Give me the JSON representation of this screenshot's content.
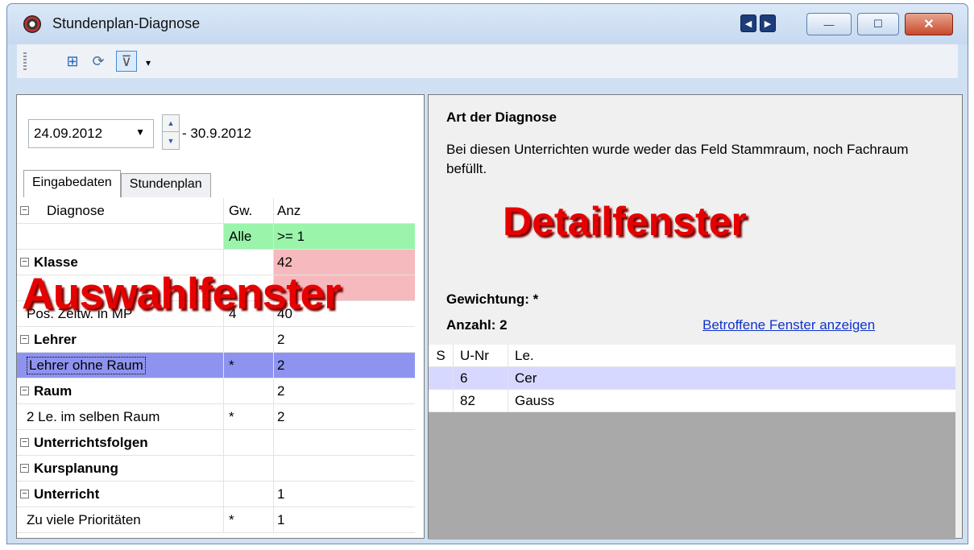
{
  "window": {
    "title": "Stundenplan-Diagnose"
  },
  "titlebar_buttons": {
    "prev": "◀",
    "next": "▶",
    "minimize": "—",
    "maximize": "☐",
    "close": "✕"
  },
  "toolbar": {
    "tools": [
      "grid-tool-icon",
      "refresh-tool-icon",
      "filter-tool-icon"
    ]
  },
  "date_range": {
    "start": "24.09.2012",
    "end": "- 30.9.2012"
  },
  "tabs": [
    {
      "label": "Eingabedaten"
    },
    {
      "label": "Stundenplan"
    }
  ],
  "grid": {
    "headers": {
      "diagnose": "Diagnose",
      "weight": "Gw.",
      "count": "Anz"
    },
    "filter": {
      "weight": "Alle",
      "count": ">= 1"
    },
    "rows": [
      {
        "label": "Klasse",
        "group": true,
        "weight": "",
        "count": "42"
      },
      {
        "label": "",
        "group": false,
        "weight": "",
        "count": ""
      },
      {
        "label": "Pos. Zeitw. in MP",
        "group": false,
        "weight": "4",
        "count": "40"
      },
      {
        "label": "Lehrer",
        "group": true,
        "weight": "",
        "count": "2"
      },
      {
        "label": "Lehrer ohne Raum",
        "group": false,
        "weight": "*",
        "count": "2"
      },
      {
        "label": "Raum",
        "group": true,
        "weight": "",
        "count": "2"
      },
      {
        "label": "2 Le. im selben Raum",
        "group": false,
        "weight": "*",
        "count": "2"
      },
      {
        "label": "Unterrichtsfolgen",
        "group": true,
        "weight": "",
        "count": ""
      },
      {
        "label": "Kursplanung",
        "group": true,
        "weight": "",
        "count": ""
      },
      {
        "label": "Unterricht",
        "group": true,
        "weight": "",
        "count": "1"
      },
      {
        "label": "Zu viele Prioritäten",
        "group": false,
        "weight": "*",
        "count": "1"
      }
    ]
  },
  "overlays": {
    "left": "Auswahlfenster",
    "right": "Detailfenster"
  },
  "detail": {
    "title": "Art der Diagnose",
    "description": "Bei diesen Unterrichten wurde weder das Feld Stammraum, noch Fachraum befüllt.",
    "weight": "Gewichtung: *",
    "count": "Anzahl: 2",
    "link": "Betroffene Fenster anzeigen",
    "table": {
      "headers": {
        "s": "S",
        "unr": "U-Nr",
        "le": "Le."
      },
      "rows": [
        {
          "s": "",
          "unr": "6",
          "le": "Cer"
        },
        {
          "s": "",
          "unr": "82",
          "le": "Gauss"
        }
      ]
    }
  },
  "colors": {
    "filter_row": "#9af5ab",
    "warning": "#f6b9bd",
    "selection": "#8f93f0",
    "overlay_text": "#e70000",
    "link": "#1033cc"
  }
}
